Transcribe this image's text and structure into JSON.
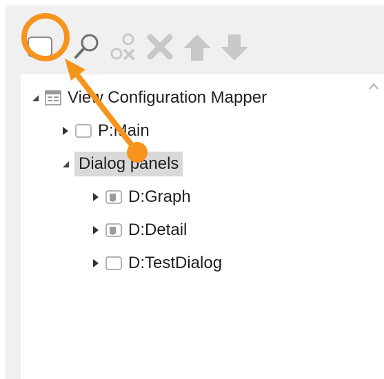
{
  "toolbar": {
    "buttons": [
      {
        "name": "new-panel",
        "icon": "panel-icon",
        "state": "enabled",
        "highlighted": true
      },
      {
        "name": "search",
        "icon": "search-icon",
        "state": "enabled"
      },
      {
        "name": "remove-mapping",
        "icon": "remove-mapping-icon",
        "state": "disabled"
      },
      {
        "name": "delete",
        "icon": "delete-x-icon",
        "state": "disabled"
      },
      {
        "name": "move-up",
        "icon": "arrow-up-icon",
        "state": "disabled"
      },
      {
        "name": "move-down",
        "icon": "arrow-down-icon",
        "state": "disabled"
      }
    ]
  },
  "tree": {
    "root": {
      "label": "View Configuration Mapper",
      "expanded": true,
      "icon": "mapper-icon"
    },
    "nodes": [
      {
        "label": "P:Main",
        "expanded": false,
        "icon": "panel-empty-icon"
      },
      {
        "label": "Dialog panels",
        "expanded": true,
        "selected": true
      },
      {
        "label": "D:Graph",
        "expanded": false,
        "icon": "dialog-panel-icon"
      },
      {
        "label": "D:Detail",
        "expanded": false,
        "icon": "dialog-panel-icon"
      },
      {
        "label": "D:TestDialog",
        "expanded": false,
        "icon": "panel-empty-icon"
      }
    ]
  },
  "colors": {
    "highlight": "#f7941d",
    "disabled_icon": "#c8c8c8",
    "selection": "#d9d9d9",
    "text": "#1f1f1f"
  }
}
